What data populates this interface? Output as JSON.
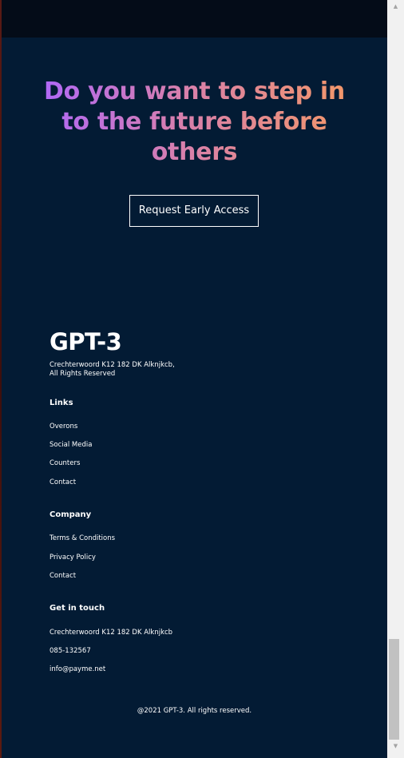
{
  "cta": {
    "heading": "Do you want to step in to the future before others",
    "button_label": "Request Early Access"
  },
  "footer": {
    "logo": "GPT-3",
    "address_line1": "Crechterwoord K12 182 DK Alknjkcb,",
    "address_line2": "All Rights Reserved",
    "links": {
      "title": "Links",
      "items": [
        "Overons",
        "Social Media",
        "Counters",
        "Contact"
      ]
    },
    "company": {
      "title": "Company",
      "items": [
        "Terms & Conditions",
        "Privacy Policy",
        "Contact"
      ]
    },
    "get_in_touch": {
      "title": "Get in touch",
      "items": [
        "Crechterwoord K12 182 DK Alknjkcb",
        "085-132567",
        "info@payme.net"
      ]
    },
    "copyright": "@2021 GPT-3. All rights reserved."
  },
  "scrollbar": {
    "up_icon": "▲",
    "down_icon": "▼"
  },
  "colors": {
    "background": "#031b34",
    "gradient_start": "#ae67fa",
    "gradient_end": "#f49867",
    "text": "#ffffff"
  }
}
